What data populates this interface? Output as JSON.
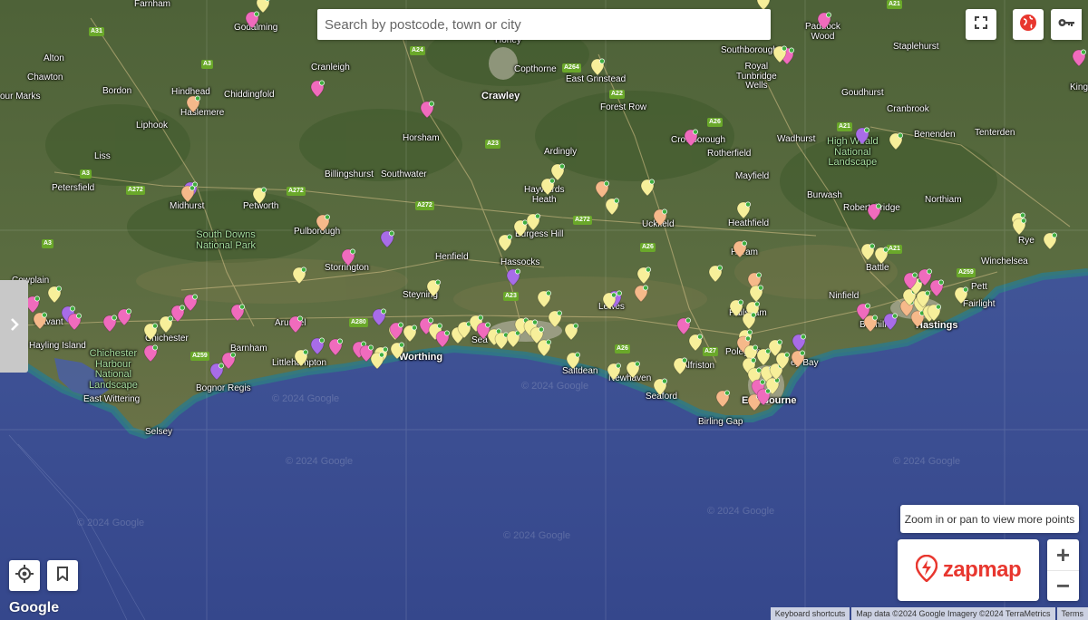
{
  "search": {
    "placeholder": "Search by postcode, town or city"
  },
  "controls": {
    "fullscreen_icon": "fullscreen-icon",
    "layers_icon": "globe-icon",
    "key_icon": "key-icon",
    "side_panel_icon": "chevron-right-icon",
    "locate_icon": "crosshair-icon",
    "bookmark_icon": "bookmark-icon",
    "zoom_in": "+",
    "zoom_out": "−"
  },
  "zoom_hint": "Zoom in or pan to view more points",
  "brand": {
    "name": "zapmap",
    "color": "#e8372f"
  },
  "google_logo": "Google",
  "attribution": {
    "shortcuts": "Keyboard shortcuts",
    "map_data": "Map data ©2024 Google Imagery ©2024 TerraMetrics",
    "terms": "Terms"
  },
  "watermark": "© 2024 Google",
  "pin_colors": {
    "yellow": "#f7ef9a",
    "orange": "#f6b98a",
    "pink": "#f06bbd",
    "purple": "#a86ce8"
  },
  "towns": {
    "farnham": "Farnham",
    "godalming": "Godalming",
    "alton": "Alton",
    "chawton": "Chawton",
    "four_marks": "our Marks",
    "bordon": "Bordon",
    "hindhead": "Hindhead",
    "haslemere": "Haslemere",
    "chiddingfold": "Chiddingfold",
    "cranleigh": "Cranleigh",
    "horley": "Horley",
    "copthorne": "Copthorne",
    "east_grinstead": "East Grinstead",
    "crawley": "Crawley",
    "forest_row": "Forest Row",
    "southborough": "Southborough",
    "royal_tunbridge_wells": "Royal\nTunbridge\nWells",
    "paddock_wood": "Paddock\nWood",
    "staplehurst": "Staplehurst",
    "liphook": "Liphook",
    "horsham": "Horsham",
    "ardingly": "Ardingly",
    "crowborough": "Crowborough",
    "rotherfield": "Rotherfield",
    "wadhurst": "Wadhurst",
    "goudhurst": "Goudhurst",
    "cranbrook": "Cranbrook",
    "benenden": "Benenden",
    "tenterden": "Tenterden",
    "high_weald": "High Weald\nNational\nLandscape",
    "liss": "Liss",
    "billingshurst": "Billingshurst",
    "southwater": "Southwater",
    "haywards_heath": "Haywards\nHeath",
    "mayfield": "Mayfield",
    "burwash": "Burwash",
    "northiam": "Northiam",
    "robertsbridge": "Robertsbridge",
    "petersfield": "Petersfield",
    "midhurst": "Midhurst",
    "petworth": "Petworth",
    "uckfield": "Uckfield",
    "heathfield": "Heathfield",
    "south_downs": "South Downs\nNational Park",
    "pulborough": "Pulborough",
    "burgess_hill": "Burgess Hill",
    "henfield": "Henfield",
    "horam": "Horam",
    "battle": "Battle",
    "rye": "Rye",
    "winchelsea": "Winchelsea",
    "storrington": "Storrington",
    "hassocks": "Hassocks",
    "cowplain": "Cowplain",
    "steyning": "Steyning",
    "lewes": "Lewes",
    "hailsham": "Hailsham",
    "ninfield": "Ninfield",
    "pett": "Pett",
    "fairlight": "Fairlight",
    "bexhill": "Bexhill",
    "hastings": "Hastings",
    "havant": "Havant",
    "chichester": "Chichester",
    "arundel": "Arundel",
    "hayling_island": "Hayling Island",
    "barnham": "Barnham",
    "worthing": "Worthing",
    "seaford_sea": "Sea",
    "saltdean": "Saltdean",
    "newhaven": "Newhaven",
    "polegate": "Polegate",
    "pevensey_bay": "ey Bay",
    "chichester_harbour": "Chichester\nHarbour\nNational\nLandscape",
    "bognor_regis": "Bognor Regis",
    "littlehampton": "Littlehampton",
    "seaford": "Seaford",
    "birling_gap": "Birling Gap",
    "eastbourne": "Eastbourne",
    "east_wittering": "East Wittering",
    "selsey": "Selsey",
    "alfriston": "Alfriston",
    "kings": "Kings"
  },
  "roads": {
    "a31": "A31",
    "a3_n": "A3",
    "a24": "A24",
    "a264": "A264",
    "a22": "A22",
    "a21": "A21",
    "a26_n": "A26",
    "a3_s": "A3",
    "a272_w": "A272",
    "a272_m": "A272",
    "a23_n": "A23",
    "a272_e": "A272",
    "a21_s": "A21",
    "a26_s": "A26",
    "a272_c": "A272",
    "a259_e": "A259",
    "a280": "A280",
    "a23_s": "A23",
    "a259_w": "A259",
    "a27": "A27",
    "a26_l": "A26",
    "a3_sw": "A3"
  }
}
